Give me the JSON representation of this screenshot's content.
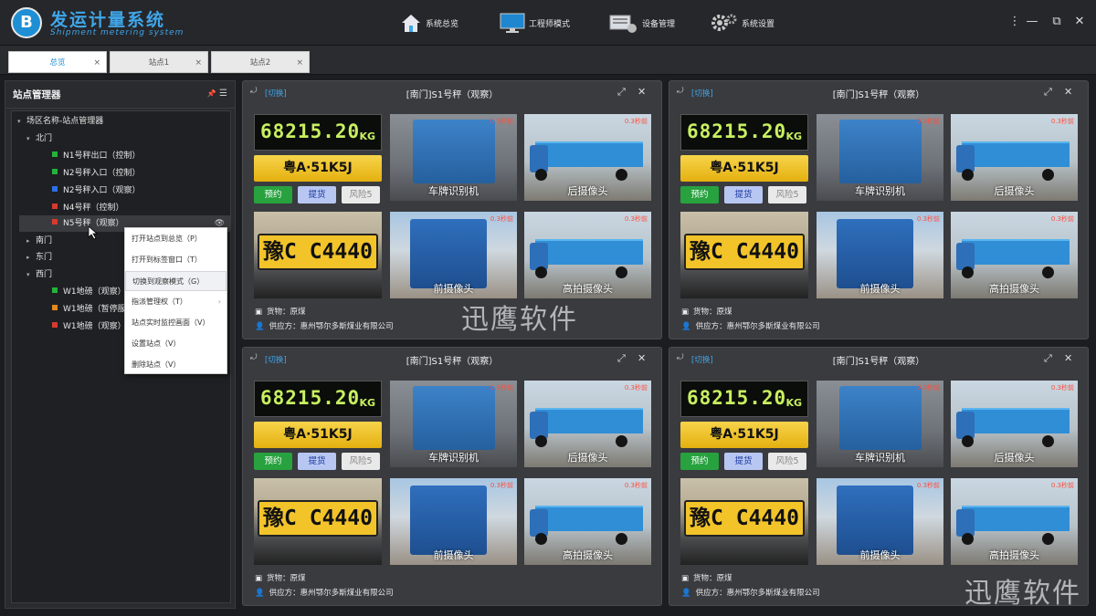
{
  "app": {
    "logo": "B",
    "title": "发运计量系统",
    "subtitle": "Shipment metering system"
  },
  "nav": [
    {
      "label": "系统总览",
      "icon": "home-icon"
    },
    {
      "label": "工程师模式",
      "icon": "monitor-icon"
    },
    {
      "label": "设备管理",
      "icon": "device-icon"
    },
    {
      "label": "系统设置",
      "icon": "gear-icon"
    }
  ],
  "window_controls": {
    "menu": "⋮",
    "minimize": "—",
    "restore": "⧉",
    "close": "✕"
  },
  "tabs": [
    {
      "label": "总览"
    },
    {
      "label": "站点1"
    },
    {
      "label": "站点2"
    }
  ],
  "tab_close": "×",
  "sidebar": {
    "title": "站点管理器",
    "pin": "📌",
    "menu": "☰",
    "tree": [
      {
        "label": "场区名称-站点管理器"
      },
      {
        "label": "北门"
      },
      {
        "label": "N1号秤出口（控制）",
        "color": "#22b43a"
      },
      {
        "label": "N2号秤入口（控制）",
        "color": "#22b43a"
      },
      {
        "label": "N2号秤入口（观察）",
        "color": "#2d6fe8"
      },
      {
        "label": "N4号秤（控制）",
        "color": "#d83a2e"
      },
      {
        "label": "N5号秤（观察）",
        "color": "#d83a2e"
      },
      {
        "label": "南门"
      },
      {
        "label": "东门"
      },
      {
        "label": "西门"
      },
      {
        "label": "W1地磅（观察）",
        "color": "#22b43a"
      },
      {
        "label": "W1地磅（暂停服",
        "color": "#e08a1e"
      },
      {
        "label": "W1地磅（观察）",
        "color": "#d83a2e"
      }
    ]
  },
  "context_menu": [
    {
      "label": "打开站点到总览（P）"
    },
    {
      "label": "打开到标签窗口（T）"
    },
    {
      "label": "切换到观察模式（G）"
    },
    {
      "label": "指派管理权（T）"
    },
    {
      "label": "站点实时监控画面（V）"
    },
    {
      "label": "设置站点（V）"
    },
    {
      "label": "删除站点（V）"
    }
  ],
  "panel": {
    "switch": "[切换]",
    "title": "[南门]S1号秤（观察）",
    "weight": "68215.20",
    "unit": "KG",
    "plate": "粤A·51K5J",
    "big_plate": "豫C C4440",
    "btn_reserve": "预约",
    "btn_pickup": "提货",
    "btn_risk": "风险5",
    "cam_plate": "车牌识别机",
    "cam_rear": "后摄像头",
    "cam_front": "前摄像头",
    "cam_high": "高拍摄像头",
    "time_ago": "0.3秒前",
    "goods": "货物：原煤",
    "supplier": "供应方：惠州鄂尔多斯煤业有限公司"
  },
  "watermark": "迅鹰软件"
}
